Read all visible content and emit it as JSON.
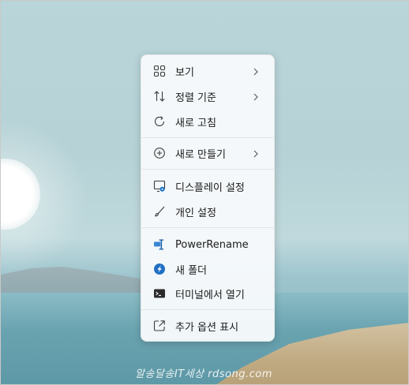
{
  "menu": {
    "items": [
      {
        "label": "보기",
        "icon": "grid-icon",
        "submenu": true
      },
      {
        "label": "정렬 기준",
        "icon": "sort-icon",
        "submenu": true
      },
      {
        "label": "새로 고침",
        "icon": "refresh-icon",
        "submenu": false
      },
      {
        "label": "새로 만들기",
        "icon": "add-circle-icon",
        "submenu": true
      },
      {
        "label": "디스플레이 설정",
        "icon": "display-settings-icon",
        "submenu": false
      },
      {
        "label": "개인 설정",
        "icon": "brush-icon",
        "submenu": false
      },
      {
        "label": "PowerRename",
        "icon": "powerrename-icon",
        "submenu": false
      },
      {
        "label": "새 폴더",
        "icon": "new-folder-icon",
        "submenu": false
      },
      {
        "label": "터미널에서 열기",
        "icon": "terminal-icon",
        "submenu": false
      },
      {
        "label": "추가 옵션 표시",
        "icon": "more-options-icon",
        "submenu": false
      }
    ]
  },
  "watermark": "알송달송IT세상 rdsong.com",
  "colors": {
    "accent": "#1a73c9",
    "menu_bg": "#f6f9fb",
    "text": "#1b1b1b"
  }
}
